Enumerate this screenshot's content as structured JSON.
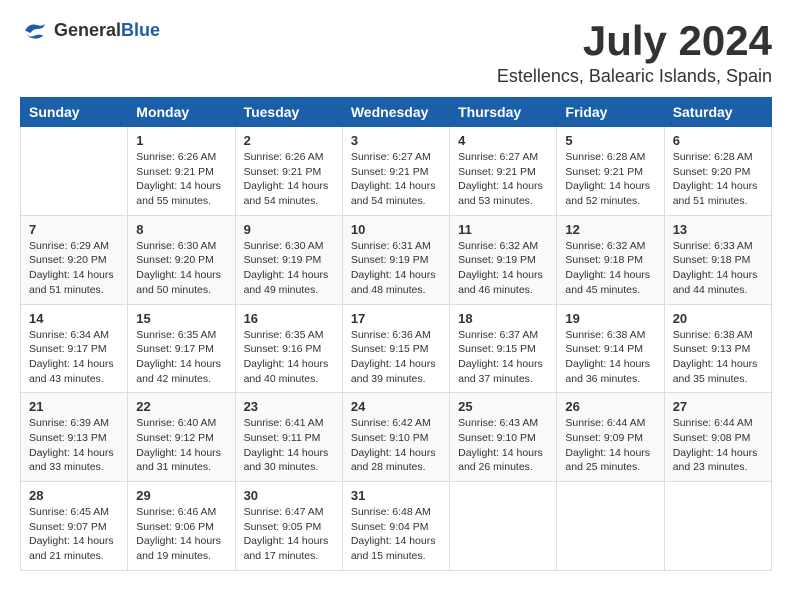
{
  "logo": {
    "general": "General",
    "blue": "Blue"
  },
  "title": "July 2024",
  "location": "Estellencs, Balearic Islands, Spain",
  "headers": [
    "Sunday",
    "Monday",
    "Tuesday",
    "Wednesday",
    "Thursday",
    "Friday",
    "Saturday"
  ],
  "weeks": [
    [
      {
        "day": "",
        "info": ""
      },
      {
        "day": "1",
        "info": "Sunrise: 6:26 AM\nSunset: 9:21 PM\nDaylight: 14 hours\nand 55 minutes."
      },
      {
        "day": "2",
        "info": "Sunrise: 6:26 AM\nSunset: 9:21 PM\nDaylight: 14 hours\nand 54 minutes."
      },
      {
        "day": "3",
        "info": "Sunrise: 6:27 AM\nSunset: 9:21 PM\nDaylight: 14 hours\nand 54 minutes."
      },
      {
        "day": "4",
        "info": "Sunrise: 6:27 AM\nSunset: 9:21 PM\nDaylight: 14 hours\nand 53 minutes."
      },
      {
        "day": "5",
        "info": "Sunrise: 6:28 AM\nSunset: 9:21 PM\nDaylight: 14 hours\nand 52 minutes."
      },
      {
        "day": "6",
        "info": "Sunrise: 6:28 AM\nSunset: 9:20 PM\nDaylight: 14 hours\nand 51 minutes."
      }
    ],
    [
      {
        "day": "7",
        "info": "Sunrise: 6:29 AM\nSunset: 9:20 PM\nDaylight: 14 hours\nand 51 minutes."
      },
      {
        "day": "8",
        "info": "Sunrise: 6:30 AM\nSunset: 9:20 PM\nDaylight: 14 hours\nand 50 minutes."
      },
      {
        "day": "9",
        "info": "Sunrise: 6:30 AM\nSunset: 9:19 PM\nDaylight: 14 hours\nand 49 minutes."
      },
      {
        "day": "10",
        "info": "Sunrise: 6:31 AM\nSunset: 9:19 PM\nDaylight: 14 hours\nand 48 minutes."
      },
      {
        "day": "11",
        "info": "Sunrise: 6:32 AM\nSunset: 9:19 PM\nDaylight: 14 hours\nand 46 minutes."
      },
      {
        "day": "12",
        "info": "Sunrise: 6:32 AM\nSunset: 9:18 PM\nDaylight: 14 hours\nand 45 minutes."
      },
      {
        "day": "13",
        "info": "Sunrise: 6:33 AM\nSunset: 9:18 PM\nDaylight: 14 hours\nand 44 minutes."
      }
    ],
    [
      {
        "day": "14",
        "info": "Sunrise: 6:34 AM\nSunset: 9:17 PM\nDaylight: 14 hours\nand 43 minutes."
      },
      {
        "day": "15",
        "info": "Sunrise: 6:35 AM\nSunset: 9:17 PM\nDaylight: 14 hours\nand 42 minutes."
      },
      {
        "day": "16",
        "info": "Sunrise: 6:35 AM\nSunset: 9:16 PM\nDaylight: 14 hours\nand 40 minutes."
      },
      {
        "day": "17",
        "info": "Sunrise: 6:36 AM\nSunset: 9:15 PM\nDaylight: 14 hours\nand 39 minutes."
      },
      {
        "day": "18",
        "info": "Sunrise: 6:37 AM\nSunset: 9:15 PM\nDaylight: 14 hours\nand 37 minutes."
      },
      {
        "day": "19",
        "info": "Sunrise: 6:38 AM\nSunset: 9:14 PM\nDaylight: 14 hours\nand 36 minutes."
      },
      {
        "day": "20",
        "info": "Sunrise: 6:38 AM\nSunset: 9:13 PM\nDaylight: 14 hours\nand 35 minutes."
      }
    ],
    [
      {
        "day": "21",
        "info": "Sunrise: 6:39 AM\nSunset: 9:13 PM\nDaylight: 14 hours\nand 33 minutes."
      },
      {
        "day": "22",
        "info": "Sunrise: 6:40 AM\nSunset: 9:12 PM\nDaylight: 14 hours\nand 31 minutes."
      },
      {
        "day": "23",
        "info": "Sunrise: 6:41 AM\nSunset: 9:11 PM\nDaylight: 14 hours\nand 30 minutes."
      },
      {
        "day": "24",
        "info": "Sunrise: 6:42 AM\nSunset: 9:10 PM\nDaylight: 14 hours\nand 28 minutes."
      },
      {
        "day": "25",
        "info": "Sunrise: 6:43 AM\nSunset: 9:10 PM\nDaylight: 14 hours\nand 26 minutes."
      },
      {
        "day": "26",
        "info": "Sunrise: 6:44 AM\nSunset: 9:09 PM\nDaylight: 14 hours\nand 25 minutes."
      },
      {
        "day": "27",
        "info": "Sunrise: 6:44 AM\nSunset: 9:08 PM\nDaylight: 14 hours\nand 23 minutes."
      }
    ],
    [
      {
        "day": "28",
        "info": "Sunrise: 6:45 AM\nSunset: 9:07 PM\nDaylight: 14 hours\nand 21 minutes."
      },
      {
        "day": "29",
        "info": "Sunrise: 6:46 AM\nSunset: 9:06 PM\nDaylight: 14 hours\nand 19 minutes."
      },
      {
        "day": "30",
        "info": "Sunrise: 6:47 AM\nSunset: 9:05 PM\nDaylight: 14 hours\nand 17 minutes."
      },
      {
        "day": "31",
        "info": "Sunrise: 6:48 AM\nSunset: 9:04 PM\nDaylight: 14 hours\nand 15 minutes."
      },
      {
        "day": "",
        "info": ""
      },
      {
        "day": "",
        "info": ""
      },
      {
        "day": "",
        "info": ""
      }
    ]
  ]
}
